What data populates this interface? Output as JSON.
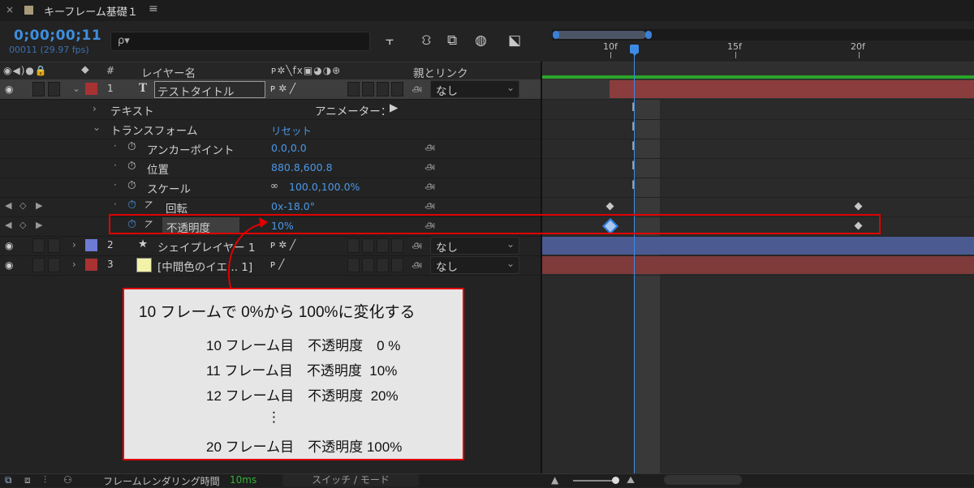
{
  "tab": {
    "close": "×",
    "title": "キーフレーム基礎１",
    "menu": "≡"
  },
  "header": {
    "timecode": "0;00;00;11",
    "fps": "00011 (29.97 fps)",
    "search_icon": "ρ▾"
  },
  "toolbar_icons": [
    "⫟",
    "⛻",
    "⧉",
    "◍",
    "⬕"
  ],
  "ruler": {
    "labels": [
      "10f",
      "15f",
      "20f"
    ]
  },
  "columns": {
    "switch_icons": "◉◀)●🔒",
    "tag_icon": "⬥",
    "number": "#",
    "layer_name": "レイヤー名",
    "switch_set": "ᴘ✲╲fx▣◕◑⊕",
    "parent": "親とリンク"
  },
  "layers": [
    {
      "num": "1",
      "type_icon": "T",
      "name": "テストタイトル",
      "switches": "ᴘ ✲ ╱",
      "parent": "なし",
      "color": "#a83232"
    },
    {
      "num": "2",
      "type_icon": "★",
      "name": "シェイプレイヤー 1",
      "switches": "ᴘ ✲ ╱",
      "parent": "なし",
      "color": "#6d7bd6"
    },
    {
      "num": "3",
      "type_icon": "",
      "name": "[中間色のイエ... 1]",
      "switches": "ᴘ   ╱",
      "parent": "なし",
      "color": "#a83232"
    }
  ],
  "props": {
    "text": "テキスト",
    "animator": "アニメーター：",
    "transform": "トランスフォーム",
    "reset": "リセット",
    "anchor": {
      "label": "アンカーポイント",
      "value": "0.0,0.0"
    },
    "position": {
      "label": "位置",
      "value": "880.8,600.8"
    },
    "scale": {
      "label": "スケール",
      "value": "100.0,100.0%"
    },
    "rotation": {
      "label": "回転",
      "value": "0x-18.0°"
    },
    "opacity": {
      "label": "不透明度",
      "value": "10%"
    }
  },
  "callout": {
    "title": "10 フレームで 0%から 100%に変化する",
    "lines": [
      "10 フレーム目　不透明度　0 %",
      "11 フレーム目　不透明度  10%",
      "12 フレーム目　不透明度  20%",
      "⋮",
      "20 フレーム目　不透明度 100%"
    ]
  },
  "bottom": {
    "render_label": "フレームレンダリング時間",
    "render_value": "10ms",
    "switch_mode": "スイッチ / モード"
  },
  "colors": {
    "accent": "#3c8ce6",
    "highlight": "#e00000",
    "workarea": "#2aa52a",
    "layer1_bar": "#8b3c3c",
    "layer2_bar": "#4b5a90",
    "layer3_bar": "#7f3a3a"
  }
}
